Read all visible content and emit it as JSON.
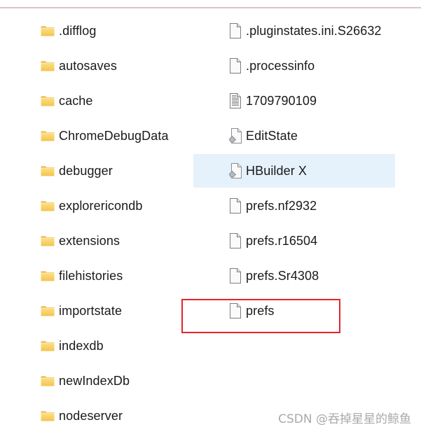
{
  "left_column": {
    "items": [
      {
        "name": ".difflog",
        "type": "folder"
      },
      {
        "name": "autosaves",
        "type": "folder"
      },
      {
        "name": "cache",
        "type": "folder"
      },
      {
        "name": "ChromeDebugData",
        "type": "folder"
      },
      {
        "name": "debugger",
        "type": "folder"
      },
      {
        "name": "explorericondb",
        "type": "folder"
      },
      {
        "name": "extensions",
        "type": "folder"
      },
      {
        "name": "filehistories",
        "type": "folder"
      },
      {
        "name": "importstate",
        "type": "folder"
      },
      {
        "name": "indexdb",
        "type": "folder"
      },
      {
        "name": "newIndexDb",
        "type": "folder"
      },
      {
        "name": "nodeserver",
        "type": "folder"
      }
    ]
  },
  "right_column": {
    "items": [
      {
        "name": ".pluginstates.ini.S26632",
        "type": "file",
        "icon": "blank-file-icon"
      },
      {
        "name": ".processinfo",
        "type": "file",
        "icon": "blank-file-icon"
      },
      {
        "name": "1709790109",
        "type": "file",
        "icon": "text-file-icon"
      },
      {
        "name": "EditState",
        "type": "file",
        "icon": "system-file-icon"
      },
      {
        "name": "HBuilder X",
        "type": "file",
        "icon": "system-file-icon",
        "selected": true
      },
      {
        "name": "prefs.nf2932",
        "type": "file",
        "icon": "blank-file-icon"
      },
      {
        "name": "prefs.r16504",
        "type": "file",
        "icon": "blank-file-icon"
      },
      {
        "name": "prefs.Sr4308",
        "type": "file",
        "icon": "blank-file-icon"
      },
      {
        "name": "prefs",
        "type": "file",
        "icon": "blank-file-icon",
        "annotated": true
      }
    ]
  },
  "annotation": {
    "color": "#e3242b",
    "target": "prefs"
  },
  "colors": {
    "selection": "#e5f1fb",
    "folder": "#f8d775",
    "top_rule": "#dcc4c6"
  },
  "watermark": "CSDN @吞掉星星的鲸鱼"
}
